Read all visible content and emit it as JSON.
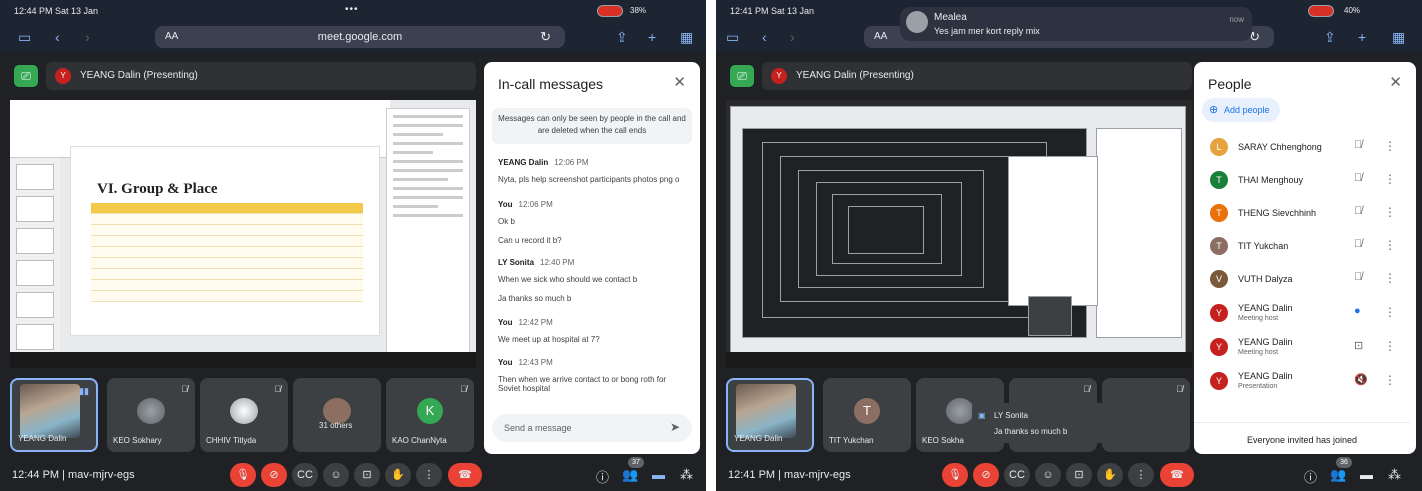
{
  "left": {
    "status": {
      "time": "12:44 PM  Sat 13 Jan",
      "battery": "38%"
    },
    "browser": {
      "url": "meet.google.com",
      "aa": "AA"
    },
    "presenting": {
      "avatar": "Y",
      "label": "YEANG Dalin (Presenting)"
    },
    "slide": {
      "heading": "VI. Group & Place"
    },
    "tiles": [
      {
        "name": "YEANG Dalin"
      },
      {
        "name": "KEO Sokhary"
      },
      {
        "name": "CHHIV Titlyda"
      },
      {
        "name": "31 others"
      },
      {
        "name": "KAO ChanNyta",
        "avatar": "K"
      }
    ],
    "bottom": {
      "time_code": "12:44 PM  |  mav-mjrv-egs",
      "people_count": "37"
    },
    "chat": {
      "title": "In-call messages",
      "notice": "Messages can only be seen by people in the call and are deleted when the call ends",
      "messages": [
        {
          "who": "YEANG Dalin",
          "ts": "12:06 PM",
          "lines": [
            "Nyta, pls help screenshot participants photos png o"
          ]
        },
        {
          "who": "You",
          "ts": "12:06 PM",
          "lines": [
            "Ok b",
            "Can u record it b?"
          ]
        },
        {
          "who": "LY Sonita",
          "ts": "12:40 PM",
          "lines": [
            "When we sick who should we contact b",
            "Ja thanks so much b"
          ]
        },
        {
          "who": "You",
          "ts": "12:42 PM",
          "lines": [
            "We meet up at hospital at 7?"
          ]
        },
        {
          "who": "You",
          "ts": "12:43 PM",
          "lines": [
            "Then when we arrive contact to or bong roth for Soviet hospital"
          ]
        }
      ],
      "placeholder": "Send a message"
    }
  },
  "right": {
    "status": {
      "time": "12:41 PM  Sat 13 Jan",
      "battery": "40%"
    },
    "notification": {
      "title": "Mealea",
      "body": "Yes jam mer kort reply mix",
      "time": "now"
    },
    "browser": {
      "aa": "AA"
    },
    "presenting": {
      "avatar": "Y",
      "label": "YEANG Dalin (Presenting)"
    },
    "tiles": [
      {
        "name": "YEANG Dalin"
      },
      {
        "name": "TIT Yukchan",
        "avatar": "T"
      },
      {
        "name": "KEO Sokha"
      }
    ],
    "toast": {
      "name": "LY Sonita",
      "text": "Ja thanks so much b"
    },
    "bottom": {
      "time_code": "12:41 PM  |  mav-mjrv-egs",
      "people_count": "36"
    },
    "people": {
      "title": "People",
      "add_label": "Add people",
      "list": [
        {
          "name": "SARAY Chhenghong",
          "avatar": "L",
          "color": "#e6a23c"
        },
        {
          "name": "THAI Menghouy",
          "avatar": "T",
          "color": "#188038"
        },
        {
          "name": "THENG Sievchhinh",
          "avatar": "T",
          "color": "#e8710a"
        },
        {
          "name": "TIT Yukchan",
          "avatar": "T",
          "color": "#8d6e63"
        },
        {
          "name": "VUTH Dalyza",
          "avatar": "V",
          "color": "#7b5a3a"
        },
        {
          "name": "YEANG Dalin",
          "role": "Meeting host",
          "avatar": "Y",
          "color": "#c5221f"
        },
        {
          "name": "YEANG Dalin",
          "role": "Meeting host",
          "avatar": "Y",
          "color": "#c5221f"
        },
        {
          "name": "YEANG Dalin",
          "role": "Presentation",
          "avatar": "Y",
          "color": "#c5221f"
        }
      ],
      "footer": "Everyone invited has joined"
    }
  },
  "icons": {
    "close": "✕",
    "mic_off": "mic-off-icon",
    "more": "⋮"
  }
}
